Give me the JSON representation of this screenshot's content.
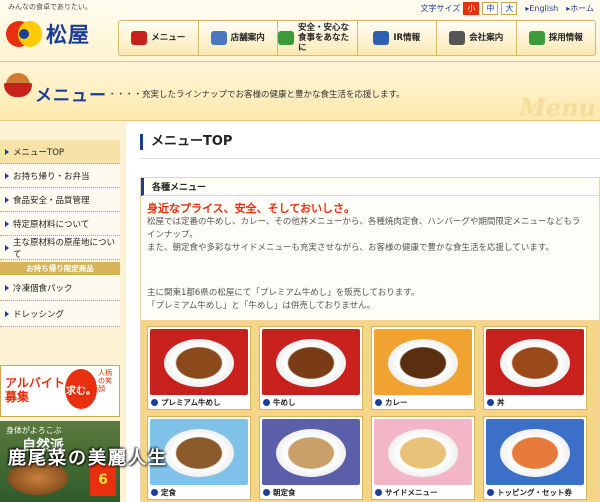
{
  "header": {
    "tagline": "みんなの食卓でありたい。",
    "logo_text": "松屋",
    "font_size_label": "文字サイズ",
    "font_sizes": [
      "小",
      "中",
      "大"
    ],
    "links": [
      "▸English",
      "▸ホーム"
    ],
    "nav": [
      {
        "label": "メニュー",
        "icon": "bowl-icon",
        "color": "#c8201c"
      },
      {
        "label": "店舗案内",
        "icon": "store-icon",
        "color": "#4a78c0"
      },
      {
        "label": "安全・安心な\n食事をあなたに",
        "icon": "leaf-icon",
        "color": "#3d9a3a"
      },
      {
        "label": "IR情報",
        "icon": "chart-icon",
        "color": "#2e5fb0"
      },
      {
        "label": "会社案内",
        "icon": "building-icon",
        "color": "#555"
      },
      {
        "label": "採用情報",
        "icon": "people-icon",
        "color": "#3d9a3a"
      }
    ]
  },
  "band": {
    "title": "メニュー",
    "desc": "・・・・充実したラインナップでお客様の健康と豊かな食生活を応援します。",
    "watermark": "Menu"
  },
  "sidebar": {
    "items": [
      {
        "label": "メニューTOP",
        "active": true
      },
      {
        "label": "お持ち帰り・お弁当",
        "active": false
      },
      {
        "label": "食品安全・品質管理",
        "active": false
      },
      {
        "label": "特定原材料について",
        "active": false
      },
      {
        "label": "主な原材料の原産地について",
        "active": false
      }
    ],
    "section_head": "お持ち帰り限定商品",
    "items2": [
      "冷凍個食パック",
      "ドレッシング"
    ],
    "banner1": {
      "title": "アルバイト\n募集",
      "badge": "求む。",
      "side": "人柄の笑顔"
    },
    "banner2": {
      "line1": "身体がよろこぶ",
      "line2": "自然派",
      "label": "6"
    }
  },
  "main": {
    "title": "メニューTOP",
    "box_head": "各種メニュー",
    "catch": "身近なプライス、安全、そしておいしさ。",
    "para": "松屋では定番の牛めし、カレー、その他丼メニューから、各種焼肉定食、ハンバーグや期間限定メニューなどもラインナップ。\nまた、朝定食や多彩なサイドメニューも充実させながら、お客様の健康で豊かな食生活を応援しています。",
    "para2": "主に関東1都6県の松屋にて「プレミアム牛めし」を販売しております。\n「プレミアム牛めし」と「牛めし」は併売しておりません。",
    "cards": [
      {
        "label": "プレミアム牛めし",
        "bg": "#c8201c",
        "food": "#8a4a1c"
      },
      {
        "label": "牛めし",
        "bg": "#c8201c",
        "food": "#7a3c16"
      },
      {
        "label": "カレー",
        "bg": "#f1a332",
        "food": "#5a2f10"
      },
      {
        "label": "丼",
        "bg": "#c8201c",
        "food": "#9a4a1a"
      },
      {
        "label": "定食",
        "bg": "#7fc1e8",
        "food": "#8a5a2a"
      },
      {
        "label": "朝定食",
        "bg": "#5b5ea8",
        "food": "#caa06a"
      },
      {
        "label": "サイドメニュー",
        "bg": "#f2b6c6",
        "food": "#e9c27a"
      },
      {
        "label": "トッピング・セット券",
        "bg": "#3b6fc8",
        "food": "#e67a3a"
      }
    ]
  },
  "overlay": {
    "text": "鹿尾菜の美麗人生"
  }
}
